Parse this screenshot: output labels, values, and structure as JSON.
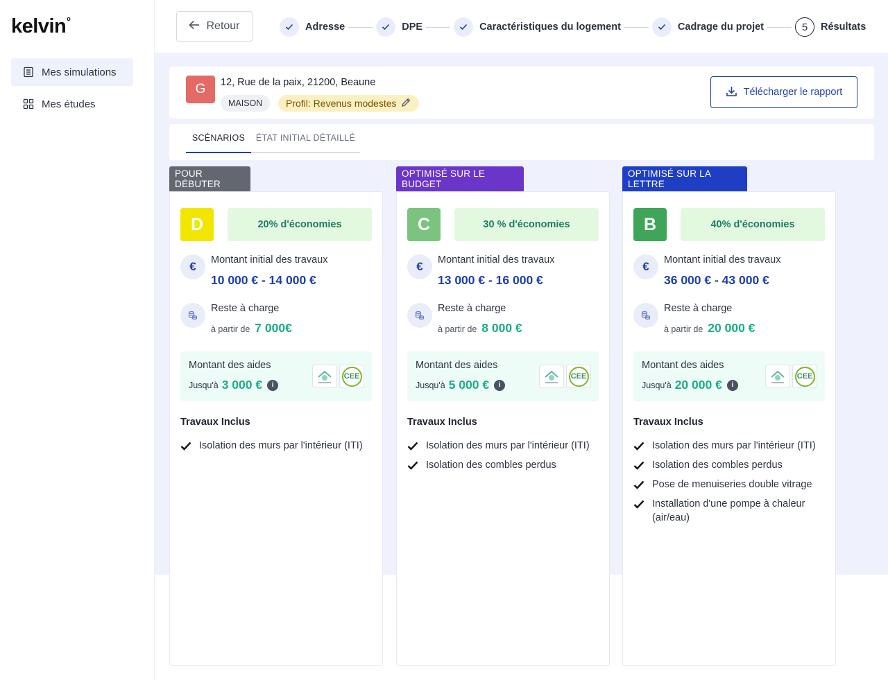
{
  "app": {
    "logo": "kelvin"
  },
  "sidebar": {
    "items": [
      {
        "label": "Mes simulations",
        "icon": "document-list-icon",
        "active": true
      },
      {
        "label": "Mes études",
        "icon": "grid-icon",
        "active": false
      }
    ]
  },
  "topbar": {
    "back_label": "Retour",
    "steps": [
      {
        "label": "Adresse",
        "state": "done"
      },
      {
        "label": "DPE",
        "state": "done"
      },
      {
        "label": "Caractéristiques du logement",
        "state": "done"
      },
      {
        "label": "Cadrage du projet",
        "state": "done"
      },
      {
        "label": "Résultats",
        "state": "current",
        "number": "5"
      }
    ]
  },
  "property": {
    "grade": "G",
    "grade_color": "#e56a66",
    "address": "12, Rue de la paix, 21200, Beaune",
    "type": "MAISON",
    "profile": "Profil: Revenus modestes",
    "download_label": "Télécharger le rapport"
  },
  "tabs": [
    {
      "label": "SCÉNARIOS",
      "active": true
    },
    {
      "label": "ÉTAT INITIAL DÉTAILLÉ",
      "active": false
    }
  ],
  "scenarios": [
    {
      "label": "POUR DÉBUTER",
      "label_color": "#636870",
      "grade": "D",
      "grade_color": "#f2e500",
      "savings": "20% d'économies",
      "initial_label": "Montant initial des travaux",
      "initial_amount": "10 000 € - 14 000 €",
      "reste_label": "Reste à charge",
      "reste_prefix": "à partir de",
      "reste_amount": "7 000€",
      "aides_title": "Montant des aides",
      "aides_prefix": "Jusqu'à",
      "aides_amount": "3 000 €",
      "cee_text": "CEE",
      "travaux_title": "Travaux Inclus",
      "travaux": [
        "Isolation des murs par l'intérieur (ITI)"
      ]
    },
    {
      "label": "OPTIMISÉ SUR LE BUDGET",
      "label_color": "#6b35c9",
      "grade": "C",
      "grade_color": "#7bc47f",
      "savings": "30 % d'économies",
      "initial_label": "Montant initial des travaux",
      "initial_amount": "13 000 € - 16 000 €",
      "reste_label": "Reste à charge",
      "reste_prefix": "à partir de",
      "reste_amount": "8 000 €",
      "aides_title": "Montant des aides",
      "aides_prefix": "Jusqu'à",
      "aides_amount": "5 000 €",
      "cee_text": "CEE",
      "travaux_title": "Travaux Inclus",
      "travaux": [
        "Isolation des murs par l'intérieur (ITI)",
        "Isolation des combles perdus"
      ]
    },
    {
      "label": "OPTIMISÉ SUR LA LETTRE",
      "label_color": "#1e3fc4",
      "grade": "B",
      "grade_color": "#3fa659",
      "savings": "40% d'économies",
      "initial_label": "Montant initial des travaux",
      "initial_amount": "36 000 € - 43 000 €",
      "reste_label": "Reste à charge",
      "reste_prefix": "à partir de",
      "reste_amount": "20 000 €",
      "aides_title": "Montant des aides",
      "aides_prefix": "Jusqu'à",
      "aides_amount": "20 000 €",
      "cee_text": "CEE",
      "travaux_title": "Travaux Inclus",
      "travaux": [
        "Isolation des murs par l'intérieur (ITI)",
        "Isolation des combles perdus",
        "Pose de menuiseries double vitrage",
        "Installation d'une pompe à chaleur (air/eau)"
      ]
    }
  ]
}
